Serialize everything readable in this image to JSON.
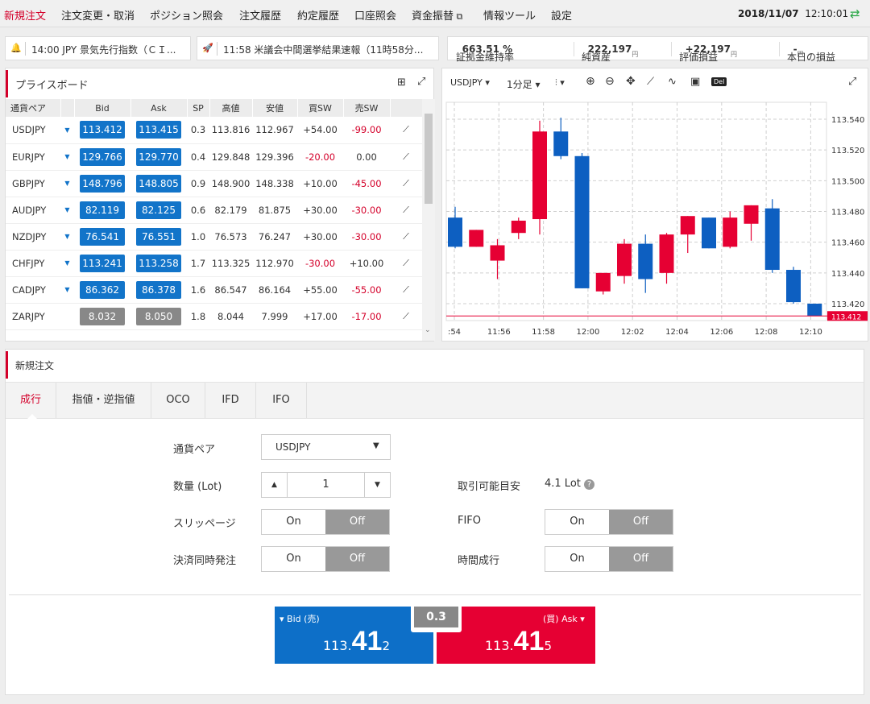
{
  "nav": {
    "items": [
      "新規注文",
      "注文変更・取消",
      "ポジション照会",
      "注文履歴",
      "約定履歴",
      "口座照会",
      "資金振替",
      "情報ツール",
      "設定"
    ],
    "date": "2018/11/07",
    "time": "12:10:01"
  },
  "news": [
    {
      "text": "14:00 JPY 景気先行指数（ＣＩ..."
    },
    {
      "text": "11:58 米議会中間選挙結果速報（11時58分..."
    }
  ],
  "account": {
    "margin_label": "証拠金維持率",
    "margin_value": "663.51 %",
    "net_label": "純資産",
    "net_value": "222,197",
    "yen": "円",
    "pl_label": "評価損益",
    "pl_value": "+22,197",
    "today_label": "本日の損益",
    "today_value": "-"
  },
  "priceboard": {
    "title": "プライスボード",
    "headers": [
      "通貨ペア",
      "",
      "Bid",
      "Ask",
      "SP",
      "高値",
      "安値",
      "買SW",
      "売SW",
      ""
    ],
    "rows": [
      {
        "pair": "USDJPY",
        "bid": "113.412",
        "ask": "113.415",
        "sp": "0.3",
        "high": "113.816",
        "low": "112.967",
        "buy": "+54.00",
        "sell": "-99.00",
        "arrow": true,
        "enabled": true
      },
      {
        "pair": "EURJPY",
        "bid": "129.766",
        "ask": "129.770",
        "sp": "0.4",
        "high": "129.848",
        "low": "129.396",
        "buy": "-20.00",
        "sell": "0.00",
        "arrow": true,
        "enabled": true
      },
      {
        "pair": "GBPJPY",
        "bid": "148.796",
        "ask": "148.805",
        "sp": "0.9",
        "high": "148.900",
        "low": "148.338",
        "buy": "+10.00",
        "sell": "-45.00",
        "arrow": true,
        "enabled": true
      },
      {
        "pair": "AUDJPY",
        "bid": "82.119",
        "ask": "82.125",
        "sp": "0.6",
        "high": "82.179",
        "low": "81.875",
        "buy": "+30.00",
        "sell": "-30.00",
        "arrow": true,
        "enabled": true
      },
      {
        "pair": "NZDJPY",
        "bid": "76.541",
        "ask": "76.551",
        "sp": "1.0",
        "high": "76.573",
        "low": "76.247",
        "buy": "+30.00",
        "sell": "-30.00",
        "arrow": true,
        "enabled": true
      },
      {
        "pair": "CHFJPY",
        "bid": "113.241",
        "ask": "113.258",
        "sp": "1.7",
        "high": "113.325",
        "low": "112.970",
        "buy": "-30.00",
        "sell": "+10.00",
        "arrow": true,
        "enabled": true
      },
      {
        "pair": "CADJPY",
        "bid": "86.362",
        "ask": "86.378",
        "sp": "1.6",
        "high": "86.547",
        "low": "86.164",
        "buy": "+55.00",
        "sell": "-55.00",
        "arrow": true,
        "enabled": true
      },
      {
        "pair": "ZARJPY",
        "bid": "8.032",
        "ask": "8.050",
        "sp": "1.8",
        "high": "8.044",
        "low": "7.999",
        "buy": "+17.00",
        "sell": "-17.00",
        "arrow": false,
        "enabled": false
      }
    ]
  },
  "chart_toolbar": {
    "pair": "USDJPY",
    "interval": "1分足",
    "del": "Del"
  },
  "chart_data": {
    "type": "candlestick",
    "y_ticks": [
      "113.540",
      "113.520",
      "113.500",
      "113.480",
      "113.460",
      "113.440",
      "113.420"
    ],
    "x_ticks": [
      ":54",
      "11:56",
      "11:58",
      "12:00",
      "12:02",
      "12:04",
      "12:06",
      "12:08",
      "12:10"
    ],
    "ylim": [
      113.409,
      113.551
    ],
    "current": "113.412",
    "colors": {
      "up": "#e60033",
      "down": "#0d5fc1"
    },
    "candles": [
      {
        "o": 113.476,
        "h": 113.483,
        "l": 113.456,
        "c": 113.457
      },
      {
        "o": 113.457,
        "h": 113.468,
        "l": 113.457,
        "c": 113.468
      },
      {
        "o": 113.448,
        "h": 113.462,
        "l": 113.436,
        "c": 113.458
      },
      {
        "o": 113.466,
        "h": 113.476,
        "l": 113.462,
        "c": 113.474
      },
      {
        "o": 113.475,
        "h": 113.539,
        "l": 113.465,
        "c": 113.532
      },
      {
        "o": 113.532,
        "h": 113.541,
        "l": 113.514,
        "c": 113.516
      },
      {
        "o": 113.516,
        "h": 113.518,
        "l": 113.43,
        "c": 113.43
      },
      {
        "o": 113.428,
        "h": 113.44,
        "l": 113.426,
        "c": 113.44
      },
      {
        "o": 113.438,
        "h": 113.462,
        "l": 113.433,
        "c": 113.459
      },
      {
        "o": 113.459,
        "h": 113.465,
        "l": 113.427,
        "c": 113.436
      },
      {
        "o": 113.44,
        "h": 113.466,
        "l": 113.433,
        "c": 113.465
      },
      {
        "o": 113.465,
        "h": 113.475,
        "l": 113.453,
        "c": 113.477
      },
      {
        "o": 113.476,
        "h": 113.474,
        "l": 113.456,
        "c": 113.456
      },
      {
        "o": 113.457,
        "h": 113.48,
        "l": 113.456,
        "c": 113.476
      },
      {
        "o": 113.472,
        "h": 113.484,
        "l": 113.461,
        "c": 113.484
      },
      {
        "o": 113.482,
        "h": 113.488,
        "l": 113.44,
        "c": 113.442
      },
      {
        "o": 113.442,
        "h": 113.444,
        "l": 113.42,
        "c": 113.421
      },
      {
        "o": 113.42,
        "h": 113.42,
        "l": 113.412,
        "c": 113.412
      }
    ]
  },
  "order": {
    "title": "新規注文",
    "tabs": [
      "成行",
      "指値・逆指値",
      "OCO",
      "IFD",
      "IFO"
    ],
    "pair_label": "通貨ペア",
    "pair_value": "USDJPY",
    "qty_label": "数量 (Lot)",
    "qty_value": "1",
    "avail_label": "取引可能目安",
    "avail_value": "4.1 Lot",
    "slip_label": "スリッページ",
    "fifo_label": "FIFO",
    "close_label": "決済同時発注",
    "time_label": "時間成行",
    "on": "On",
    "off": "Off",
    "bid_label": "Bid (売)",
    "ask_label": "(買) Ask",
    "bid_a": "113.",
    "bid_b": "41",
    "bid_c": "2",
    "ask_a": "113.",
    "ask_b": "41",
    "ask_c": "5",
    "spread": "0.3",
    "colors": {
      "bid": "#0d6fc8",
      "ask": "#e60033"
    }
  }
}
